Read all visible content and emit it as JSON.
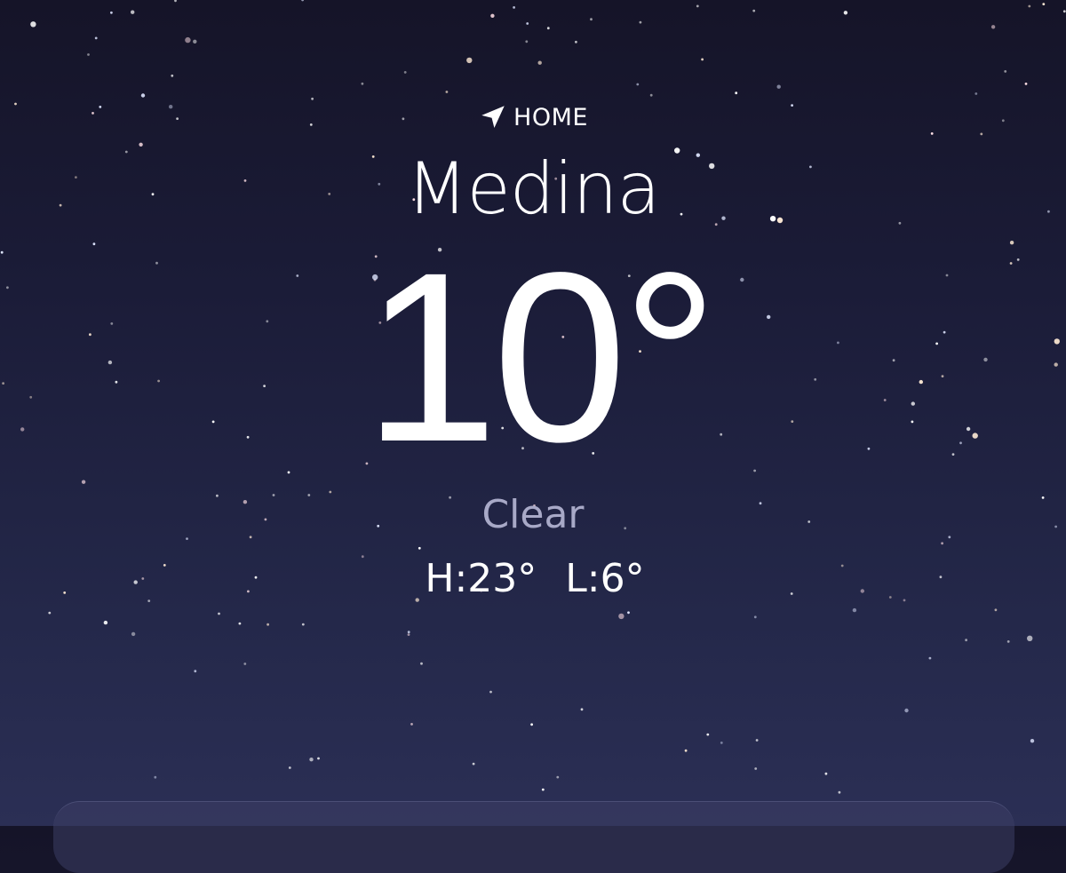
{
  "location": {
    "icon": "location-arrow-icon",
    "label": "HOME",
    "city": "Medina"
  },
  "weather": {
    "temperature": "10°",
    "condition": "Clear",
    "high_low": "H:23°  L:6°"
  },
  "colors": {
    "background_top": "#151428",
    "background_bottom": "#2b2f55",
    "text_primary": "#ffffff",
    "text_condition": "#a8a9c7",
    "card_background": "#3c3e64"
  }
}
